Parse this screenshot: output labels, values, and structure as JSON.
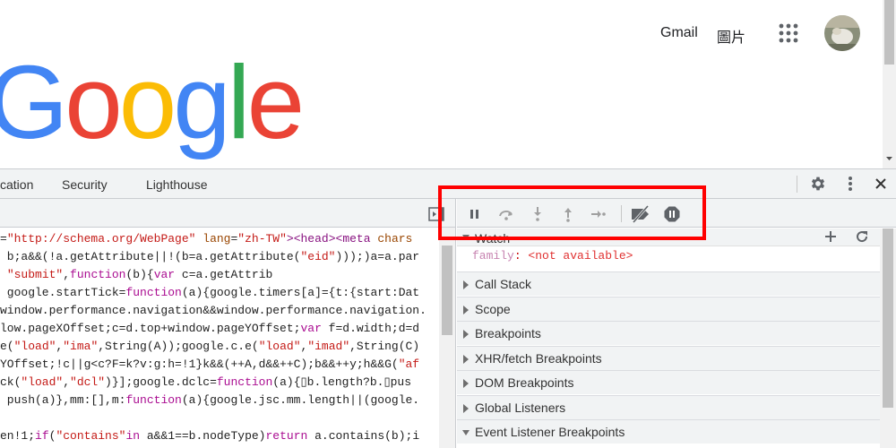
{
  "google": {
    "header": {
      "gmail": "Gmail",
      "images": "圖片"
    },
    "logo": {
      "letters": [
        "G",
        "o",
        "o",
        "g",
        "l",
        "e"
      ],
      "colors": [
        "#4285f4",
        "#ea4335",
        "#fbbc05",
        "#4285f4",
        "#34a853",
        "#ea4335"
      ]
    }
  },
  "devtools": {
    "tabs": [
      "cation",
      "Security",
      "Lighthouse"
    ],
    "code_lines": [
      [
        "=",
        {
          "s": "\"http://schema.org/WebPage\""
        },
        " ",
        {
          "a": "lang"
        },
        "=",
        {
          "s": "\"zh-TW\""
        },
        {
          "t": "><head><meta"
        },
        " ",
        {
          "a": "chars"
        }
      ],
      [
        " b;a&&(!a.getAttribute||!(b=a.getAttribute(",
        {
          "s": "\"eid\""
        },
        ")));)a=a.par"
      ],
      [
        " ",
        {
          "s": "\"submit\""
        },
        ",",
        {
          "k": "function"
        },
        "(b){",
        {
          "k": "var"
        },
        " c=a.getAttrib"
      ],
      [
        " google.startTick=",
        {
          "k": "function"
        },
        "(a){google.timers[a]={t:{start:Dat"
      ],
      [
        "window.performance.navigation&&window.performance.navigation."
      ],
      [
        "low.pageXOffset;c=d.top+window.pageYOffset;",
        {
          "k": "var"
        },
        " f=d.width;d=d"
      ],
      [
        "e(",
        {
          "s": "\"load\""
        },
        ",",
        {
          "s": "\"ima\""
        },
        ",String(A));google.c.e(",
        {
          "s": "\"load\""
        },
        ",",
        {
          "s": "\"imad\""
        },
        ",String(C)"
      ],
      [
        "YOffset;!c||g<c?F=k?v:g:h=!1}k&&(++A,d&&++C);b&&++y;h&&G(",
        {
          "s": "\"af"
        }
      ],
      [
        "ck(",
        {
          "s": "\"load\""
        },
        ",",
        {
          "s": "\"dcl\""
        },
        ")}];google.dclc=",
        {
          "k": "function"
        },
        "(a){▯b.length?b.▯pus"
      ],
      [
        " push(a)},mm:[],m:",
        {
          "k": "function"
        },
        "(a){google.jsc.mm.length||(google."
      ],
      [
        ""
      ],
      [
        "en!1;",
        {
          "k": "if"
        },
        "(",
        {
          "s": "\"contains\""
        },
        {
          "k": "in"
        },
        " a&&1==b.nodeType)",
        {
          "k": "return"
        },
        " a.contains(b);i"
      ],
      [
        "ction(a,b){",
        {
          "k": "var"
        },
        " d=G;d.g=a;d.h=b;",
        {
          "k": "return"
        },
        " d};F.prototype.i=func"
      ]
    ],
    "watch": {
      "label": "Watch",
      "expr_name": "family",
      "expr_value": "<not available>"
    },
    "sections": [
      "Call Stack",
      "Scope",
      "Breakpoints",
      "XHR/fetch Breakpoints",
      "DOM Breakpoints",
      "Global Listeners",
      "Event Listener Breakpoints"
    ],
    "debug_buttons": [
      "pause-icon",
      "step-over-icon",
      "step-into-icon",
      "step-out-icon",
      "step-icon",
      "deactivate-breakpoints-icon",
      "pause-on-exceptions-icon"
    ]
  },
  "colors": {
    "highlight": "#ff0000"
  }
}
